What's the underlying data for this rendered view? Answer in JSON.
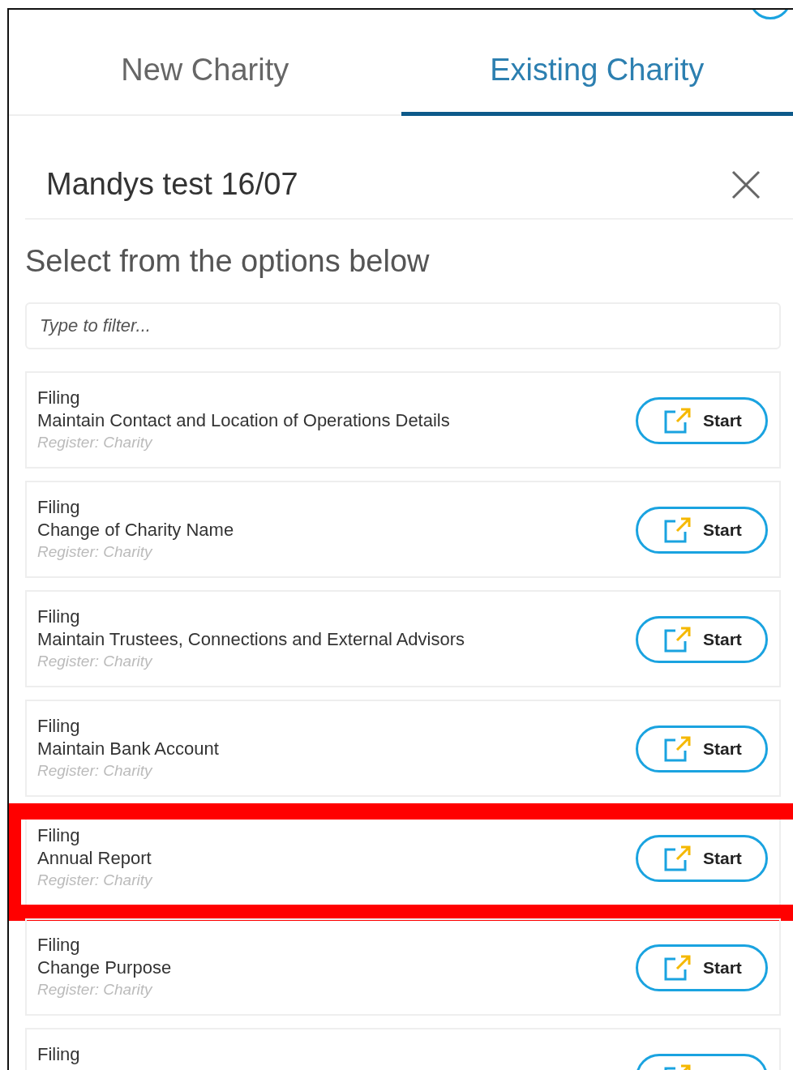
{
  "tabs": [
    {
      "label": "New Charity",
      "selected": false
    },
    {
      "label": "Existing Charity",
      "selected": true
    }
  ],
  "dialog": {
    "title": "Mandys test 16/07",
    "heading": "Select from the options below"
  },
  "filter": {
    "placeholder": "Type to filter..."
  },
  "options": [
    {
      "category": "Filing",
      "title": "Maintain Contact and Location of Operations Details",
      "register": "Register: Charity",
      "button": "Start",
      "highlighted": false
    },
    {
      "category": "Filing",
      "title": "Change of Charity Name",
      "register": "Register: Charity",
      "button": "Start",
      "highlighted": false
    },
    {
      "category": "Filing",
      "title": "Maintain Trustees, Connections and External Advisors",
      "register": "Register: Charity",
      "button": "Start",
      "highlighted": false
    },
    {
      "category": "Filing",
      "title": "Maintain Bank Account",
      "register": "Register: Charity",
      "button": "Start",
      "highlighted": false
    },
    {
      "category": "Filing",
      "title": "Annual Report",
      "register": "Register: Charity",
      "button": "Start",
      "highlighted": true
    },
    {
      "category": "Filing",
      "title": "Change Purpose",
      "register": "Register: Charity",
      "button": "Start",
      "highlighted": false
    },
    {
      "category": "Filing",
      "highlighted": false
    }
  ]
}
